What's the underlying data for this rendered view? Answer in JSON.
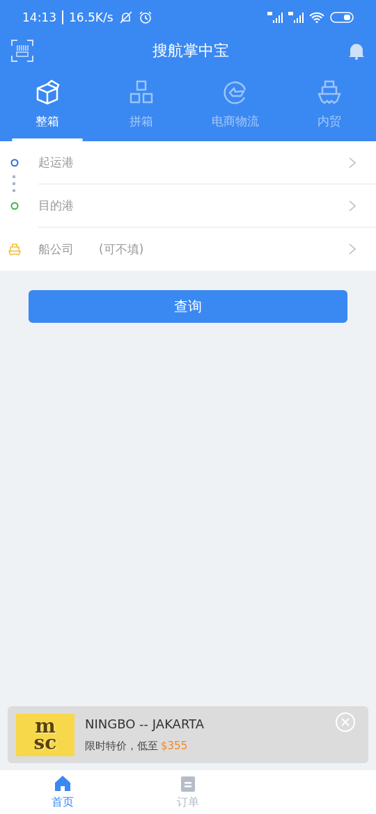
{
  "status_bar": {
    "time": "14:13",
    "speed": "16.5K/s"
  },
  "header": {
    "title": "搜航掌中宝"
  },
  "tabs": [
    {
      "label": "整箱",
      "kind": "box",
      "selected": true
    },
    {
      "label": "拼箱",
      "kind": "blocks",
      "selected": false
    },
    {
      "label": "电商物流",
      "kind": "ecommerce",
      "selected": false
    },
    {
      "label": "内贸",
      "kind": "ship",
      "selected": false
    }
  ],
  "form": {
    "rows": [
      {
        "kind": "origin",
        "placeholder": "起运港"
      },
      {
        "kind": "destination",
        "placeholder": "目的港"
      },
      {
        "kind": "carrier",
        "placeholder": "船公司",
        "hint": "(可不填)"
      }
    ]
  },
  "search_button": "查询",
  "ad": {
    "logo_lines": [
      "m",
      "sc"
    ],
    "route": "NINGBO -- JAKARTA",
    "promo": "限时特价，低至",
    "price": "$355"
  },
  "bottom_nav": [
    {
      "label": "首页",
      "kind": "home",
      "selected": true
    },
    {
      "label": "订单",
      "kind": "orders",
      "selected": false
    }
  ]
}
